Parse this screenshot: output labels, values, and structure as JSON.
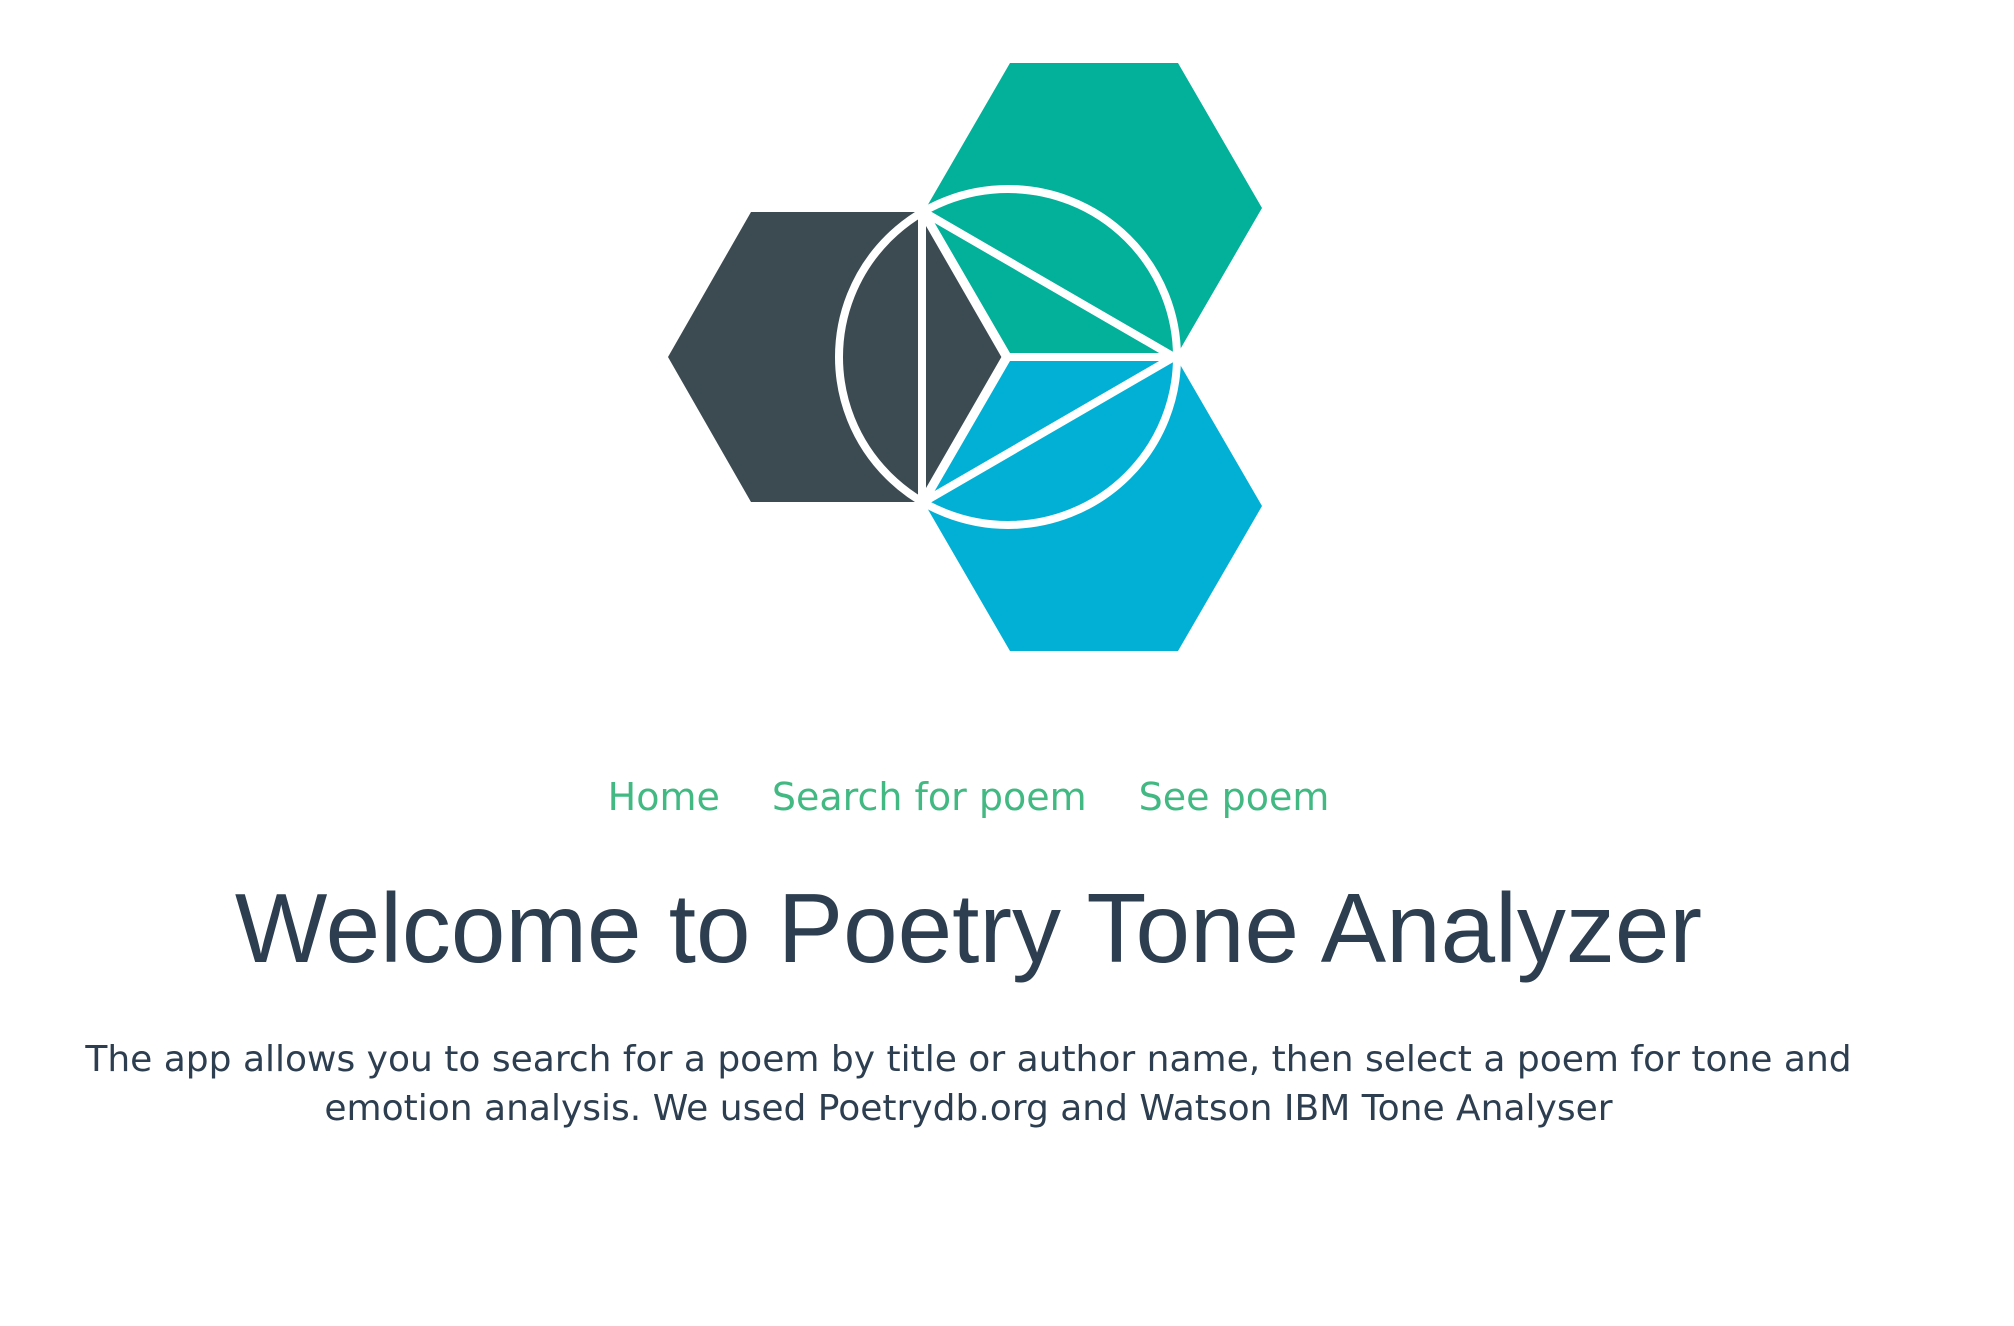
{
  "logo": {
    "name": "IBM Bluemix logo",
    "colors": {
      "dark": "#3c4a52",
      "green": "#03b09a",
      "blue": "#01b0d4",
      "stroke": "#ffffff"
    }
  },
  "nav": {
    "items": [
      {
        "label": "Home"
      },
      {
        "label": "Search for poem"
      },
      {
        "label": "See poem"
      }
    ],
    "color": "#42b983"
  },
  "main": {
    "title": "Welcome to Poetry Tone Analyzer",
    "description": "The app allows you to search for a poem by title or author name, then select a poem for tone and emotion analysis. We used Poetrydb.org and Watson IBM Tone Analyser"
  },
  "colors": {
    "text": "#2c3e50",
    "background": "#ffffff"
  }
}
